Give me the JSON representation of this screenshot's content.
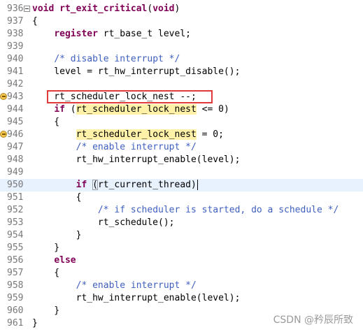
{
  "editor": {
    "lines": [
      {
        "num": "936",
        "code": [
          {
            "t": "void",
            "c": "kw"
          },
          {
            "t": " "
          },
          {
            "t": "rt_exit_critical",
            "c": "kw"
          },
          {
            "t": "("
          },
          {
            "t": "void",
            "c": "kw"
          },
          {
            "t": ")"
          }
        ]
      },
      {
        "num": "937",
        "code": [
          {
            "t": "{"
          }
        ]
      },
      {
        "num": "938",
        "code": [
          {
            "t": "    "
          },
          {
            "t": "register",
            "c": "kw"
          },
          {
            "t": " rt_base_t level;"
          }
        ]
      },
      {
        "num": "939",
        "code": []
      },
      {
        "num": "940",
        "code": [
          {
            "t": "    "
          },
          {
            "t": "/* disable interrupt */",
            "c": "cm"
          }
        ]
      },
      {
        "num": "941",
        "code": [
          {
            "t": "    level = rt_hw_interrupt_disable();"
          }
        ]
      },
      {
        "num": "942",
        "code": []
      },
      {
        "num": "943",
        "code": [
          {
            "t": "    rt_scheduler_lock_nest --;"
          }
        ]
      },
      {
        "num": "944",
        "code": [
          {
            "t": "    "
          },
          {
            "t": "if",
            "c": "kw"
          },
          {
            "t": " ("
          },
          {
            "t": "rt_scheduler_lock_nest",
            "c": "hl"
          },
          {
            "t": " <= 0)"
          }
        ]
      },
      {
        "num": "945",
        "code": [
          {
            "t": "    {"
          }
        ]
      },
      {
        "num": "946",
        "code": [
          {
            "t": "        "
          },
          {
            "t": "rt_scheduler_lock_nest",
            "c": "hl"
          },
          {
            "t": " = 0;"
          }
        ]
      },
      {
        "num": "947",
        "code": [
          {
            "t": "        "
          },
          {
            "t": "/* enable interrupt */",
            "c": "cm"
          }
        ]
      },
      {
        "num": "948",
        "code": [
          {
            "t": "        rt_hw_interrupt_enable(level);"
          }
        ]
      },
      {
        "num": "949",
        "code": []
      },
      {
        "num": "950",
        "code": [
          {
            "t": "        "
          },
          {
            "t": "if",
            "c": "kw"
          },
          {
            "t": " "
          },
          {
            "t": "(",
            "c": "bracket"
          },
          {
            "t": "rt_current_thread)"
          },
          {
            "t": "",
            "c": "caret"
          }
        ]
      },
      {
        "num": "951",
        "code": [
          {
            "t": "        {"
          }
        ]
      },
      {
        "num": "952",
        "code": [
          {
            "t": "            "
          },
          {
            "t": "/* if scheduler is started, do a schedule */",
            "c": "cm"
          }
        ]
      },
      {
        "num": "953",
        "code": [
          {
            "t": "            rt_schedule();"
          }
        ]
      },
      {
        "num": "954",
        "code": [
          {
            "t": "        }"
          }
        ]
      },
      {
        "num": "955",
        "code": [
          {
            "t": "    }"
          }
        ]
      },
      {
        "num": "956",
        "code": [
          {
            "t": "    "
          },
          {
            "t": "else",
            "c": "kw"
          }
        ]
      },
      {
        "num": "957",
        "code": [
          {
            "t": "    {"
          }
        ]
      },
      {
        "num": "958",
        "code": [
          {
            "t": "        "
          },
          {
            "t": "/* enable interrupt */",
            "c": "cm"
          }
        ]
      },
      {
        "num": "959",
        "code": [
          {
            "t": "        rt_hw_interrupt_enable(level);"
          }
        ]
      },
      {
        "num": "960",
        "code": [
          {
            "t": "    }"
          }
        ]
      },
      {
        "num": "961",
        "code": [
          {
            "t": "}"
          }
        ]
      }
    ],
    "fold_lines": [
      "936"
    ],
    "marker_lines": [
      "943",
      "946"
    ],
    "current_line": "950",
    "highlighted_line": "943"
  },
  "watermark": "CSDN @矜辰所致",
  "colors": {
    "keyword": "#7f0055",
    "comment": "#3f5fbf",
    "occurrence_highlight": "#fff2a8",
    "current_line_bg": "#e8f2fe",
    "annotation_box": "#e03a3a"
  }
}
